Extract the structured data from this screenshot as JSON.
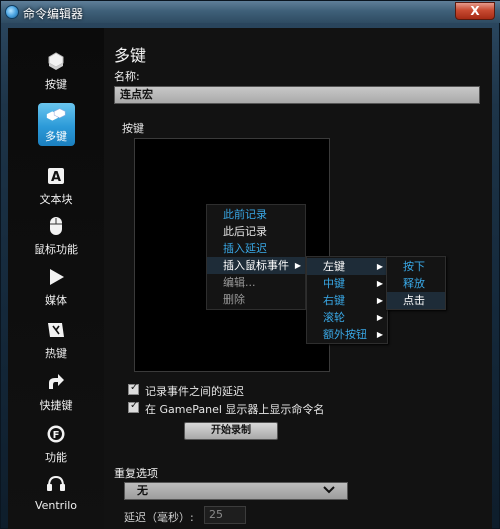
{
  "window": {
    "title": "命令编辑器",
    "close_label": "X"
  },
  "sidebar": {
    "items": [
      {
        "label": "按键",
        "icon": "keycap-icon",
        "active": false
      },
      {
        "label": "多键",
        "icon": "multi-key-icon",
        "active": true
      },
      {
        "label": "文本块",
        "icon": "text-block-icon",
        "active": false
      },
      {
        "label": "鼠标功能",
        "icon": "mouse-icon",
        "active": false
      },
      {
        "label": "媒体",
        "icon": "play-icon",
        "active": false
      },
      {
        "label": "热键",
        "icon": "hotkey-icon",
        "active": false
      },
      {
        "label": "快捷键",
        "icon": "shortcut-arrow-icon",
        "active": false
      },
      {
        "label": "功能",
        "icon": "function-icon",
        "active": false
      },
      {
        "label": "Ventrilo",
        "icon": "headset-icon",
        "active": false
      }
    ]
  },
  "main": {
    "title": "多键",
    "name_label": "名称:",
    "name_value": "连点宏",
    "keys_label": "按键"
  },
  "context_menu": {
    "items": [
      {
        "label": "此前记录",
        "style": "blue"
      },
      {
        "label": "此后记录",
        "style": "normal"
      },
      {
        "label": "插入延迟",
        "style": "blue"
      },
      {
        "label": "插入鼠标事件",
        "style": "highlight",
        "submenu": true
      },
      {
        "label": "编辑...",
        "style": "gray"
      },
      {
        "label": "删除",
        "style": "gray"
      }
    ]
  },
  "mouse_submenu": {
    "items": [
      {
        "label": "左键",
        "style": "highlight",
        "submenu": true
      },
      {
        "label": "中键",
        "style": "blue",
        "submenu": true
      },
      {
        "label": "右键",
        "style": "blue",
        "submenu": true
      },
      {
        "label": "滚轮",
        "style": "blue",
        "submenu": true
      },
      {
        "label": "额外按钮",
        "style": "blue",
        "submenu": true
      }
    ]
  },
  "action_submenu": {
    "items": [
      {
        "label": "按下",
        "style": "blue"
      },
      {
        "label": "释放",
        "style": "blue"
      },
      {
        "label": "点击",
        "style": "highlight"
      }
    ]
  },
  "options": {
    "record_delay_label": "记录事件之间的延迟",
    "record_delay_checked": true,
    "show_on_gamepanel_label": "在 GamePanel 显示器上显示命令名",
    "show_on_gamepanel_checked": true,
    "start_record_button": "开始录制"
  },
  "repeat": {
    "label": "重复选项",
    "selected": "无",
    "delay_label": "延迟（毫秒）:",
    "delay_value": "25"
  },
  "colors": {
    "accent_blue": "#39a8e6",
    "active_tab": "#2c9ad8",
    "close_red": "#c84b32"
  }
}
